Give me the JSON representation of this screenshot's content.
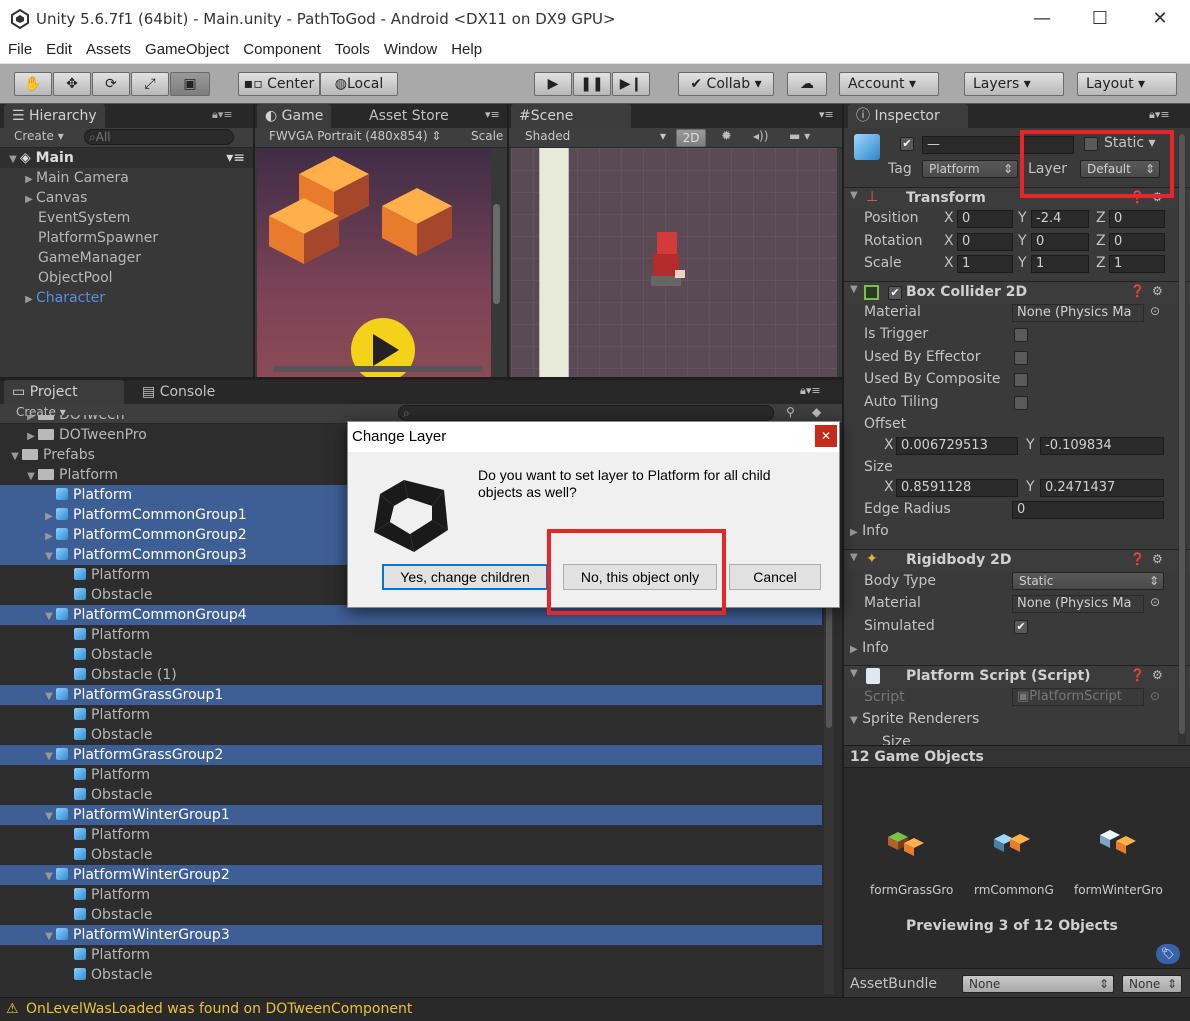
{
  "window": {
    "title": "Unity 5.6.7f1 (64bit) - Main.unity - PathToGod - Android <DX11 on DX9 GPU>"
  },
  "menu": [
    "File",
    "Edit",
    "Assets",
    "GameObject",
    "Component",
    "Tools",
    "Window",
    "Help"
  ],
  "toolbar": {
    "center": "Center",
    "local": "Local",
    "collab": "Collab",
    "account": "Account",
    "layers": "Layers",
    "layout": "Layout"
  },
  "hierarchy": {
    "tab": "Hierarchy",
    "create": "Create",
    "search_placeholder": "All",
    "scene": "Main",
    "items": [
      "Main Camera",
      "Canvas",
      "EventSystem",
      "PlatformSpawner",
      "GameManager",
      "ObjectPool",
      "Character"
    ]
  },
  "game": {
    "tab": "Game",
    "asset_store_tab": "Asset Store",
    "resolution": "FWVGA Portrait (480x854)",
    "scale": "Scale"
  },
  "scene": {
    "tab": "Scene",
    "shaded": "Shaded",
    "mode2d": "2D"
  },
  "project": {
    "tab": "Project",
    "console_tab": "Console",
    "create": "Create",
    "rows": [
      {
        "label": "DOTween",
        "indent": 1,
        "kind": "folder",
        "sel": false
      },
      {
        "label": "DOTweenPro",
        "indent": 1,
        "kind": "folder",
        "sel": false
      },
      {
        "label": "Prefabs",
        "indent": 0,
        "kind": "folder",
        "sel": false,
        "open": true
      },
      {
        "label": "Platform",
        "indent": 1,
        "kind": "folder",
        "sel": false,
        "open": true
      },
      {
        "label": "Platform",
        "indent": 2,
        "kind": "prefab",
        "sel": true
      },
      {
        "label": "PlatformCommonGroup1",
        "indent": 2,
        "kind": "prefab",
        "sel": true,
        "tri": "closed"
      },
      {
        "label": "PlatformCommonGroup2",
        "indent": 2,
        "kind": "prefab",
        "sel": true,
        "tri": "closed"
      },
      {
        "label": "PlatformCommonGroup3",
        "indent": 2,
        "kind": "prefab",
        "sel": true,
        "tri": "open"
      },
      {
        "label": "Platform",
        "indent": 3,
        "kind": "prefab",
        "sel": false
      },
      {
        "label": "Obstacle",
        "indent": 3,
        "kind": "prefab",
        "sel": false
      },
      {
        "label": "PlatformCommonGroup4",
        "indent": 2,
        "kind": "prefab",
        "sel": true,
        "tri": "open"
      },
      {
        "label": "Platform",
        "indent": 3,
        "kind": "prefab",
        "sel": false
      },
      {
        "label": "Obstacle",
        "indent": 3,
        "kind": "prefab",
        "sel": false
      },
      {
        "label": "Obstacle (1)",
        "indent": 3,
        "kind": "prefab",
        "sel": false
      },
      {
        "label": "PlatformGrassGroup1",
        "indent": 2,
        "kind": "prefab",
        "sel": true,
        "tri": "open"
      },
      {
        "label": "Platform",
        "indent": 3,
        "kind": "prefab",
        "sel": false
      },
      {
        "label": "Obstacle",
        "indent": 3,
        "kind": "prefab",
        "sel": false
      },
      {
        "label": "PlatformGrassGroup2",
        "indent": 2,
        "kind": "prefab",
        "sel": true,
        "tri": "open"
      },
      {
        "label": "Platform",
        "indent": 3,
        "kind": "prefab",
        "sel": false
      },
      {
        "label": "Obstacle",
        "indent": 3,
        "kind": "prefab",
        "sel": false
      },
      {
        "label": "PlatformWinterGroup1",
        "indent": 2,
        "kind": "prefab",
        "sel": true,
        "tri": "open"
      },
      {
        "label": "Platform",
        "indent": 3,
        "kind": "prefab",
        "sel": false
      },
      {
        "label": "Obstacle",
        "indent": 3,
        "kind": "prefab",
        "sel": false
      },
      {
        "label": "PlatformWinterGroup2",
        "indent": 2,
        "kind": "prefab",
        "sel": true,
        "tri": "open"
      },
      {
        "label": "Platform",
        "indent": 3,
        "kind": "prefab",
        "sel": false
      },
      {
        "label": "Obstacle",
        "indent": 3,
        "kind": "prefab",
        "sel": false
      },
      {
        "label": "PlatformWinterGroup3",
        "indent": 2,
        "kind": "prefab",
        "sel": true,
        "tri": "open"
      },
      {
        "label": "Platform",
        "indent": 3,
        "kind": "prefab",
        "sel": false
      },
      {
        "label": "Obstacle",
        "indent": 3,
        "kind": "prefab",
        "sel": false
      }
    ]
  },
  "inspector": {
    "tab": "Inspector",
    "name_value": "—",
    "static": "Static",
    "tag_label": "Tag",
    "tag_value": "Platform",
    "layer_label": "Layer",
    "layer_value": "Default",
    "transform": {
      "title": "Transform",
      "position": {
        "label": "Position",
        "x": "0",
        "y": "-2.4",
        "z": "0"
      },
      "rotation": {
        "label": "Rotation",
        "x": "0",
        "y": "0",
        "z": "0"
      },
      "scale": {
        "label": "Scale",
        "x": "1",
        "y": "1",
        "z": "1"
      }
    },
    "box_collider": {
      "title": "Box Collider 2D",
      "material_label": "Material",
      "material_value": "None (Physics Ma",
      "is_trigger": "Is Trigger",
      "used_by_effector": "Used By Effector",
      "used_by_composite": "Used By Composite",
      "auto_tiling": "Auto Tiling",
      "offset_label": "Offset",
      "offset_x": "0.006729513",
      "offset_y": "-0.109834",
      "size_label": "Size",
      "size_x": "0.8591128",
      "size_y": "0.2471437",
      "edge_radius_label": "Edge Radius",
      "edge_radius_value": "0",
      "info": "Info"
    },
    "rigidbody": {
      "title": "Rigidbody 2D",
      "body_type_label": "Body Type",
      "body_type_value": "Static",
      "material_label": "Material",
      "material_value": "None (Physics Ma",
      "simulated": "Simulated",
      "info": "Info"
    },
    "platform_script": {
      "title": "Platform Script (Script)",
      "script_label": "Script",
      "script_value": "PlatformScript",
      "sprite_renderers": "Sprite Renderers",
      "size": "Size"
    },
    "preview": {
      "count_title": "12 Game Objects",
      "items": [
        "formGrassGro",
        "rmCommonG",
        "formWinterGro"
      ],
      "caption": "Previewing 3 of 12 Objects"
    },
    "assetbundle": {
      "label": "AssetBundle",
      "value": "None",
      "variant": "None"
    }
  },
  "dialog": {
    "title": "Change Layer",
    "message": "Do you want to set layer to Platform for all child objects as well?",
    "yes": "Yes, change children",
    "no": "No, this object only",
    "cancel": "Cancel"
  },
  "status": {
    "message": "OnLevelWasLoaded was found on DOTweenComponent"
  }
}
